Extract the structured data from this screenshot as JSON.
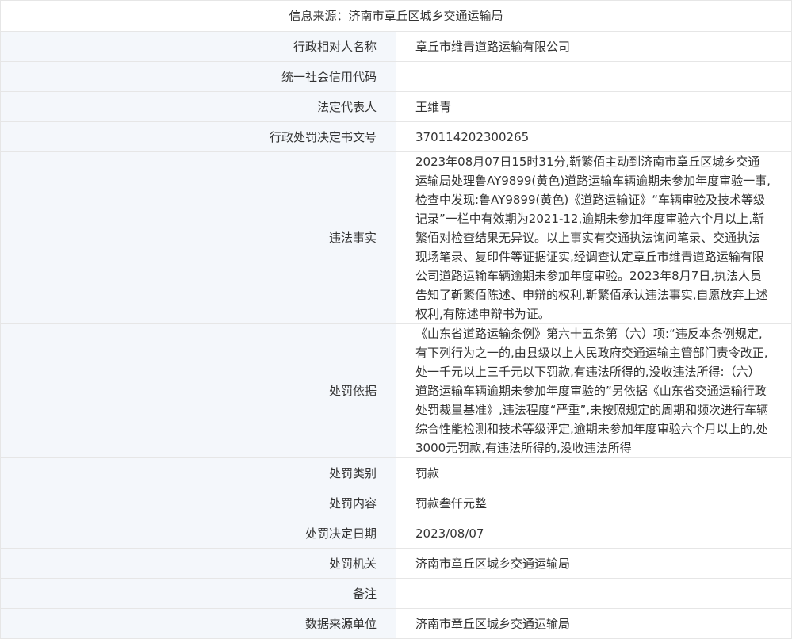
{
  "source": {
    "label": "信息来源：",
    "value": "济南市章丘区城乡交通运输局"
  },
  "rows": [
    {
      "label": "行政相对人名称",
      "value": "章丘市维青道路运输有限公司"
    },
    {
      "label": "统一社会信用代码",
      "value": ""
    },
    {
      "label": "法定代表人",
      "value": "王维青"
    },
    {
      "label": "行政处罚决定书文号",
      "value": "370114202300265"
    },
    {
      "label": "违法事实",
      "value": "2023年08月07日15时31分,靳繁佰主动到济南市章丘区城乡交通运输局处理鲁AY9899(黄色)道路运输车辆逾期未参加年度审验一事,检查中发现:鲁AY9899(黄色)《道路运输证》“车辆审验及技术等级记录”一栏中有效期为2021-12,逾期未参加年度审验六个月以上,靳繁佰对检查结果无异议。以上事实有交通执法询问笔录、交通执法现场笔录、复印件等证据证实,经调查认定章丘市维青道路运输有限公司道路运输车辆逾期未参加年度审验。2023年8月7日,执法人员告知了靳繁佰陈述、申辩的权利,靳繁佰承认违法事实,自愿放弃上述权利,有陈述申辩书为证。"
    },
    {
      "label": "处罚依据",
      "value": "《山东省道路运输条例》第六十五条第（六）项:“违反本条例规定,有下列行为之一的,由县级以上人民政府交通运输主管部门责令改正,处一千元以上三千元以下罚款,有违法所得的,没收违法所得:（六）道路运输车辆逾期未参加年度审验的”另依据《山东省交通运输行政处罚裁量基准》,违法程度“严重”,未按照规定的周期和频次进行车辆综合性能检测和技术等级评定,逾期未参加年度审验六个月以上的,处3000元罚款,有违法所得的,没收违法所得"
    },
    {
      "label": "处罚类别",
      "value": "罚款"
    },
    {
      "label": "处罚内容",
      "value": "罚款叁仟元整"
    },
    {
      "label": "处罚决定日期",
      "value": "2023/08/07"
    },
    {
      "label": "处罚机关",
      "value": "济南市章丘区城乡交通运输局"
    },
    {
      "label": "备注",
      "value": ""
    },
    {
      "label": "数据来源单位",
      "value": "济南市章丘区城乡交通运输局"
    }
  ]
}
